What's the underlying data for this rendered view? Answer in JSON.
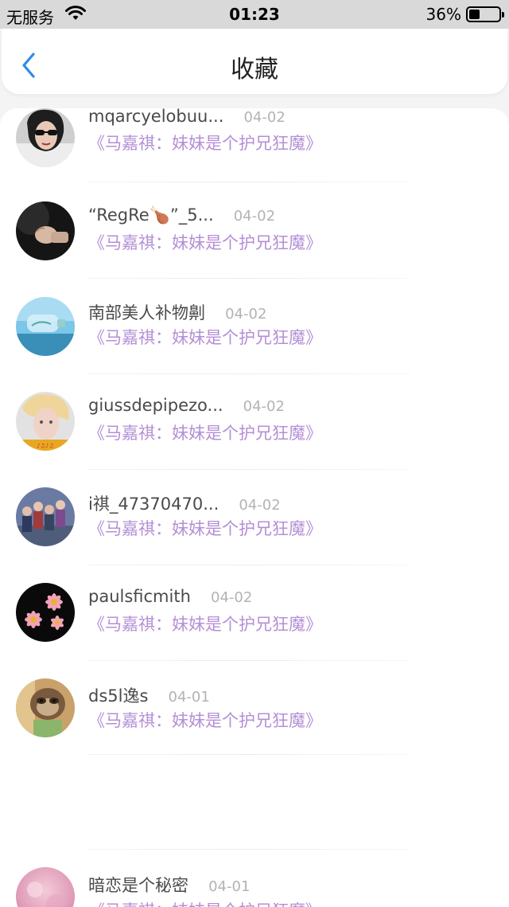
{
  "status_bar": {
    "carrier": "无服务",
    "time": "01:23",
    "battery": "36%",
    "battery_level": 0.36
  },
  "nav": {
    "title": "收藏",
    "back_icon": "chevron-left-icon",
    "accent_color": "#2f8be8"
  },
  "subtitle_color": "#b48fd6",
  "items": [
    {
      "name": "mqarcyelobuu...",
      "date": "04-02",
      "subtitle": "《马嘉祺：妹妹是个护兄狂魔》",
      "avatar": "woman-sunglasses-avatar"
    },
    {
      "name": "“RegRe🍗”_5...",
      "date": "04-02",
      "subtitle": "《马嘉祺：妹妹是个护兄狂魔》",
      "avatar": "fist-dark-avatar"
    },
    {
      "name": "南部美人补物劓",
      "date": "04-02",
      "subtitle": "《马嘉祺：妹妹是个护兄狂魔》",
      "avatar": "bottle-sea-avatar"
    },
    {
      "name": "giussdepipezo...",
      "date": "04-02",
      "subtitle": "《马嘉祺：妹妹是个护兄狂魔》",
      "avatar": "blond-person-avatar"
    },
    {
      "name": "i祺_47370470...",
      "date": "04-02",
      "subtitle": "《马嘉祺：妹妹是个护兄狂魔》",
      "avatar": "group-photo-avatar"
    },
    {
      "name": "paulsficmith",
      "date": "04-02",
      "subtitle": "《马嘉祺：妹妹是个护兄狂魔》",
      "avatar": "pink-flowers-avatar"
    },
    {
      "name": "ds5l逸s",
      "date": "04-01",
      "subtitle": "《马嘉祺：妹妹是个护兄狂魔》",
      "avatar": "sloth-avatar"
    },
    {
      "name": "暗恋是个秘密",
      "date": "04-01",
      "subtitle": "《马嘉祺：妹妹是个护兄狂魔》",
      "avatar": "pink-blur-avatar"
    }
  ]
}
